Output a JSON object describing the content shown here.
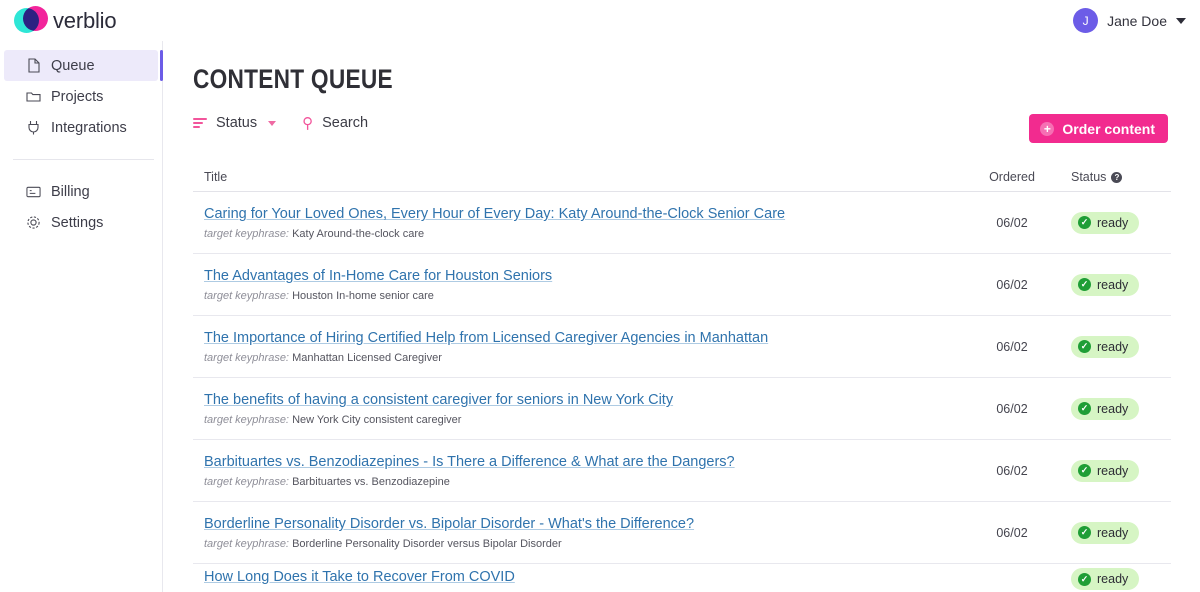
{
  "brand": {
    "name": "verblio",
    "logo_icon": "verblio-circles-logo",
    "colors": {
      "teal": "#2ee6d6",
      "magenta": "#f2249b"
    }
  },
  "user": {
    "initial": "J",
    "name": "Jane Doe",
    "caret_icon": "chevron-down-icon"
  },
  "sidebar": {
    "items": [
      {
        "label": "Queue",
        "icon": "file-icon",
        "active": true
      },
      {
        "label": "Projects",
        "icon": "folder-icon",
        "active": false
      },
      {
        "label": "Integrations",
        "icon": "plug-icon",
        "active": false
      },
      {
        "label": "Billing",
        "icon": "card-icon",
        "active": false
      },
      {
        "label": "Settings",
        "icon": "gear-icon",
        "active": false
      }
    ]
  },
  "page": {
    "title": "CONTENT QUEUE"
  },
  "toolbar": {
    "status_label": "Status",
    "status_icon": "filter-icon",
    "status_caret": "chevron-down-icon",
    "search_label": "Search",
    "search_icon": "search-icon",
    "order_button": {
      "label": "Order content",
      "icon": "plus-circle-icon",
      "color": "#f22b8f"
    }
  },
  "table": {
    "headers": {
      "title": "Title",
      "ordered": "Ordered",
      "status": "Status",
      "status_help_icon": "help-icon",
      "status_help_glyph": "?"
    },
    "keyphrase_label": "target keyphrase:",
    "rows": [
      {
        "title": "Caring for Your Loved Ones, Every Hour of Every Day: Katy Around-the-Clock Senior Care",
        "keyphrase": "Katy Around-the-clock care",
        "ordered": "06/02",
        "status": "ready"
      },
      {
        "title": "The Advantages of In-Home Care for Houston Seniors",
        "keyphrase": "Houston In-home senior care",
        "ordered": "06/02",
        "status": "ready"
      },
      {
        "title": "The Importance of Hiring Certified Help from Licensed Caregiver Agencies in Manhattan",
        "keyphrase": "Manhattan Licensed Caregiver",
        "ordered": "06/02",
        "status": "ready"
      },
      {
        "title": "The benefits of having a consistent caregiver for seniors in New York City",
        "keyphrase": "New York City consistent caregiver",
        "ordered": "06/02",
        "status": "ready"
      },
      {
        "title": "Barbituartes vs. Benzodiazepines - Is There a Difference & What are the Dangers?",
        "keyphrase": "Barbituartes vs. Benzodiazepine",
        "ordered": "06/02",
        "status": "ready"
      },
      {
        "title": "Borderline Personality Disorder vs. Bipolar Disorder - What's the Difference?",
        "keyphrase": "Borderline Personality Disorder versus Bipolar Disorder",
        "ordered": "06/02",
        "status": "ready"
      },
      {
        "title": "How Long Does it Take to Recover From COVID",
        "keyphrase": "",
        "ordered": "",
        "status": "ready"
      }
    ]
  }
}
